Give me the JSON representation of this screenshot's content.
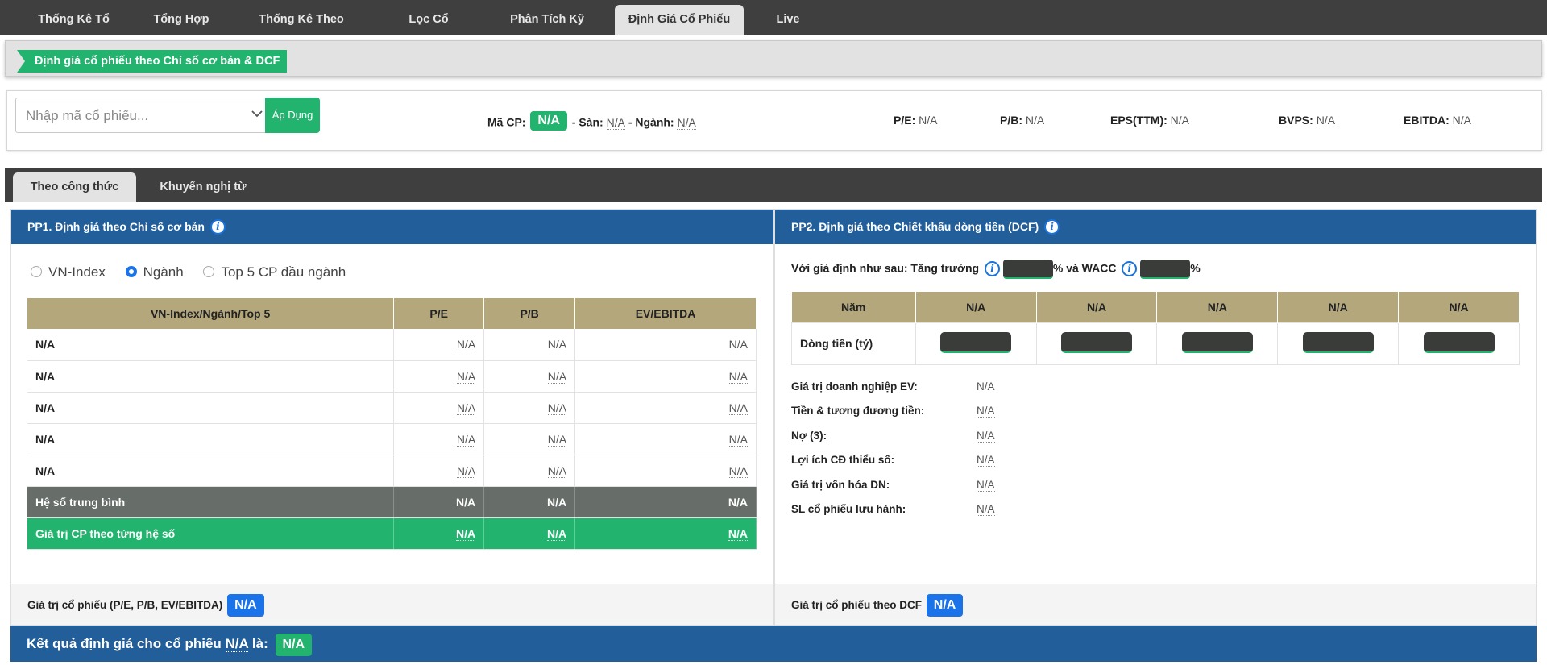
{
  "topnav": {
    "tabs": [
      {
        "label": "Thống Kê Tổ Chức"
      },
      {
        "label": "Tổng Hợp"
      },
      {
        "label": "Thống Kê Theo Ngành"
      },
      {
        "label": "Lọc Cổ Phiếu"
      },
      {
        "label": "Phân Tích Kỹ Thuật"
      },
      {
        "label": "Định Giá Cổ Phiếu"
      },
      {
        "label": "Live Board"
      }
    ],
    "active_tab": "Định Giá Cổ Phiếu"
  },
  "page_title": "Định giá cổ phiếu theo Chỉ số cơ bản & DCF",
  "search": {
    "placeholder": "Nhập mã cổ phiếu...",
    "apply_label": "Áp Dụng"
  },
  "stock_info": {
    "ma_cp_label": "Mã CP:",
    "ma_cp_value": "N/A",
    "san_label": "- Sàn:",
    "san_value": "N/A",
    "nganh_label": "- Ngành:",
    "nganh_value": "N/A",
    "pe_label": "P/E:",
    "pe_value": "N/A",
    "pb_label": "P/B:",
    "pb_value": "N/A",
    "eps_label": "EPS(TTM):",
    "eps_value": "N/A",
    "bvps_label": "BVPS:",
    "bvps_value": "N/A",
    "ebitda_label": "EBITDA:",
    "ebitda_value": "N/A"
  },
  "subnav": {
    "tabs": [
      {
        "label": "Theo công thức"
      },
      {
        "label": "Khuyến nghị từ CTCK"
      }
    ],
    "active_tab": "Theo công thức"
  },
  "pp1": {
    "title": "PP1. Định giá theo Chỉ số cơ bản",
    "radios": [
      {
        "label": "VN-Index",
        "checked": false
      },
      {
        "label": "Ngành",
        "checked": true
      },
      {
        "label": "Top 5 CP đầu ngành",
        "checked": false
      }
    ],
    "headers": [
      "VN-Index/Ngành/Top 5",
      "P/E",
      "P/B",
      "EV/EBITDA"
    ],
    "rows": [
      [
        "N/A",
        "N/A",
        "N/A",
        "N/A"
      ],
      [
        "N/A",
        "N/A",
        "N/A",
        "N/A"
      ],
      [
        "N/A",
        "N/A",
        "N/A",
        "N/A"
      ],
      [
        "N/A",
        "N/A",
        "N/A",
        "N/A"
      ],
      [
        "N/A",
        "N/A",
        "N/A",
        "N/A"
      ]
    ],
    "avg_row": [
      "Hệ số trung bình",
      "N/A",
      "N/A",
      "N/A"
    ],
    "value_row": [
      "Giá trị CP theo từng hệ số",
      "N/A",
      "N/A",
      "N/A"
    ],
    "footer_label": "Giá trị cổ phiếu (P/E, P/B, EV/EBITDA)",
    "footer_value": "N/A"
  },
  "pp2": {
    "title": "PP2. Định giá theo Chiết khấu dòng tiền (DCF)",
    "assumption_prefix": "Với giả định như sau: Tăng trưởng",
    "assumption_mid": "% và WACC",
    "assumption_suffix": "%",
    "headers": [
      "Năm",
      "N/A",
      "N/A",
      "N/A",
      "N/A",
      "N/A"
    ],
    "cashflow_label": "Dòng tiền (tỷ)",
    "metrics": [
      {
        "label": "Giá trị doanh nghiệp EV:",
        "value": "N/A"
      },
      {
        "label": "Tiền & tương đương tiền:",
        "value": "N/A"
      },
      {
        "label": "Nợ (3):",
        "value": "N/A"
      },
      {
        "label": "Lợi ích CĐ thiểu số:",
        "value": "N/A"
      },
      {
        "label": "Giá trị vốn hóa DN:",
        "value": "N/A"
      },
      {
        "label": "SL cổ phiếu lưu hành:",
        "value": "N/A"
      }
    ],
    "footer_label": "Giá trị cổ phiếu theo DCF",
    "footer_value": "N/A"
  },
  "result": {
    "prefix": "Kết quả định giá cho cổ phiếu",
    "ticker": "N/A",
    "suffix": "là:",
    "value": "N/A"
  },
  "colors": {
    "nav_bg": "#3f3f3f",
    "accent_green": "#22b46e",
    "header_blue": "#215e9a",
    "table_header_tan": "#b4a77c",
    "avg_row_gray": "#676d69",
    "badge_blue": "#1a73e8"
  }
}
